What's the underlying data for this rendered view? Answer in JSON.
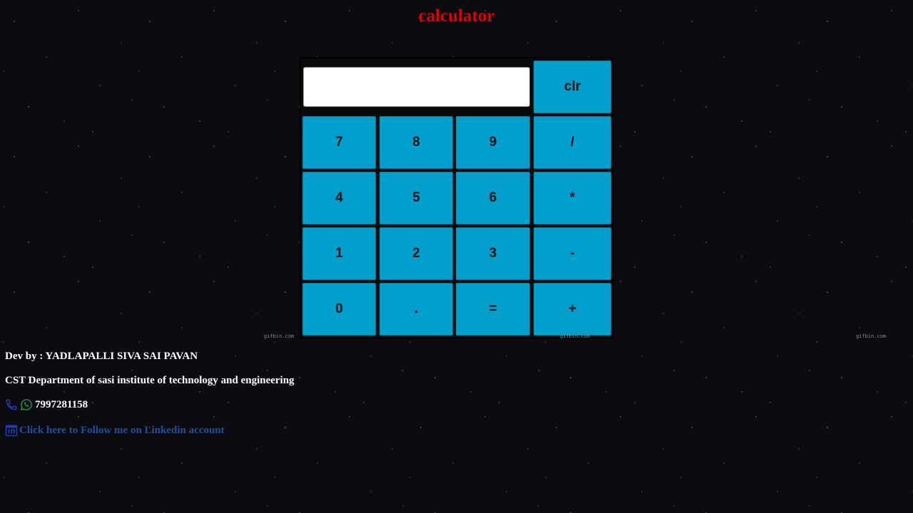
{
  "page": {
    "title": "calculator"
  },
  "calculator": {
    "display_value": "",
    "clear_label": "clr",
    "keys": {
      "seven": "7",
      "eight": "8",
      "nine": "9",
      "divide": "/",
      "four": "4",
      "five": "5",
      "six": "6",
      "multiply": "*",
      "one": "1",
      "two": "2",
      "three": "3",
      "subtract": "-",
      "zero": "0",
      "decimal": ".",
      "equals": "=",
      "add": "+"
    }
  },
  "watermarks": {
    "left": "gifbin.com",
    "center": "gifbin.com",
    "right": "gifbin.com"
  },
  "footer": {
    "dev": "Dev by : YADLAPALLI SIVA SAI PAVAN",
    "department": "CST Department of sasi institute of technology and engineering",
    "phone": "7997281158",
    "linkedin_text": "Click here to Follow me on Linkedin account"
  },
  "icons": {
    "phone": "phone-icon",
    "whatsapp": "whatsapp-icon",
    "linkedin": "linkedin-icon"
  },
  "colors": {
    "title": "#e00000",
    "key_background": "#039fcc",
    "page_background": "#0c0c10",
    "link": "#1d4fa8",
    "phone_icon": "#2244cc",
    "whatsapp_icon": "#1aa34a",
    "linkedin_icon": "#1a3cc8"
  }
}
